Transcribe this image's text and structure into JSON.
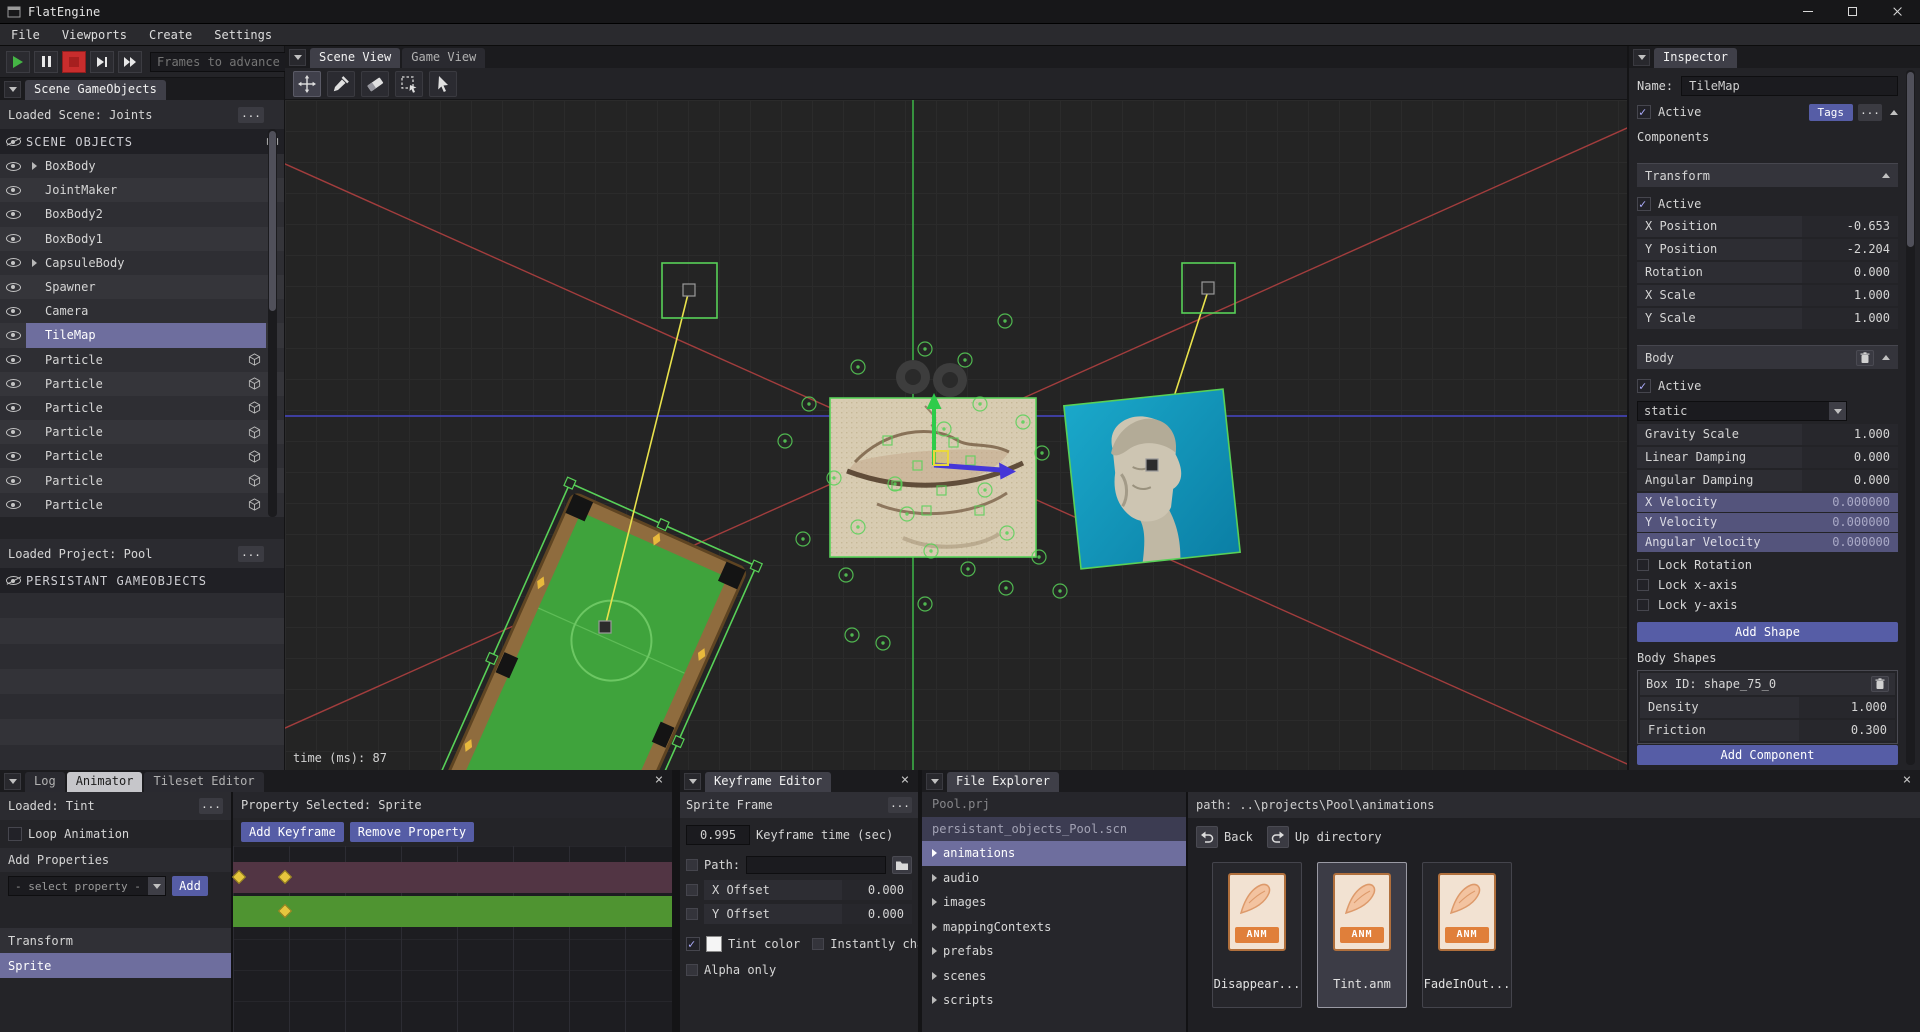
{
  "colors": {
    "accent": "#6e6e9e",
    "button": "#565da6",
    "selection-green": "#58d158",
    "axis-red": "#a23d3d",
    "axis-green": "#3cae46",
    "axis-blue": "#4646c8",
    "joint-yellow": "#e9e24c",
    "keyframe-yellow": "#e6c63e",
    "track-maroon": "#523544",
    "track-green": "#4f9431",
    "felt-green": "#3fa33c",
    "rail-brown": "#8f6c3e",
    "anm-orange": "#e07f3a",
    "play-green": "#45b545",
    "stop-red": "#c92d2d"
  },
  "window": {
    "title": "FlatEngine"
  },
  "menubar": {
    "items": [
      {
        "label": "File"
      },
      {
        "label": "Viewports"
      },
      {
        "label": "Create"
      },
      {
        "label": "Settings"
      }
    ]
  },
  "playbar": {
    "frames_placeholder": "Frames to advance"
  },
  "hierarchy": {
    "tab": "Scene GameObjects",
    "loaded": "Loaded Scene: Joints",
    "dots": "...",
    "header": "SCENE OBJECTS",
    "rows": [
      {
        "label": "BoxBody"
      },
      {
        "label": "JointMaker"
      },
      {
        "label": "BoxBody2"
      },
      {
        "label": "BoxBody1"
      },
      {
        "label": "CapsuleBody"
      },
      {
        "label": "Spawner"
      },
      {
        "label": "Camera"
      },
      {
        "label": "TileMap"
      },
      {
        "label": "Particle"
      },
      {
        "label": "Particle"
      },
      {
        "label": "Particle"
      },
      {
        "label": "Particle"
      },
      {
        "label": "Particle"
      },
      {
        "label": "Particle"
      },
      {
        "label": "Particle"
      }
    ]
  },
  "persistant": {
    "tab": "Persistant GameObjects",
    "loaded": "Loaded Project: Pool",
    "dots": "...",
    "header": "PERSISTANT GAMEOBJECTS"
  },
  "viewport": {
    "tabs": [
      {
        "label": "Scene View"
      },
      {
        "label": "Game View"
      }
    ],
    "time_text": "time (ms): 87"
  },
  "inspector": {
    "tab": "Inspector",
    "name_label": "Name:",
    "name_value": "TileMap",
    "active_label": "Active",
    "tags_button": "Tags",
    "dots": "...",
    "components_label": "Components",
    "transform": {
      "title": "Transform",
      "active_label": "Active",
      "fields": [
        {
          "label": "X Position",
          "value": "-0.653"
        },
        {
          "label": "Y Position",
          "value": "-2.204"
        },
        {
          "label": "Rotation",
          "value": "0.000"
        },
        {
          "label": "X Scale",
          "value": "1.000"
        },
        {
          "label": "Y Scale",
          "value": "1.000"
        }
      ]
    },
    "body": {
      "title": "Body",
      "active_label": "Active",
      "type_value": "static",
      "fields": [
        {
          "label": "Gravity Scale",
          "value": "1.000"
        },
        {
          "label": "Linear Damping",
          "value": "0.000"
        },
        {
          "label": "Angular Damping",
          "value": "0.000"
        }
      ],
      "velocity_fields": [
        {
          "label": "X Velocity",
          "value": "0.000000"
        },
        {
          "label": "Y Velocity",
          "value": "0.000000"
        },
        {
          "label": "Angular Velocity",
          "value": "0.000000"
        }
      ],
      "locks": [
        {
          "label": "Lock Rotation"
        },
        {
          "label": "Lock x-axis"
        },
        {
          "label": "Lock y-axis"
        }
      ],
      "add_shape_button": "Add Shape",
      "body_shapes_label": "Body Shapes",
      "shape": {
        "id_label": "Box ID: shape_75_0",
        "fields": [
          {
            "label": "Density",
            "value": "1.000"
          },
          {
            "label": "Friction",
            "value": "0.300"
          }
        ]
      }
    },
    "add_component_button": "Add Component"
  },
  "animator": {
    "tabs": [
      {
        "label": "Log"
      },
      {
        "label": "Animator"
      },
      {
        "label": "Tileset Editor"
      }
    ],
    "loaded": "Loaded: Tint",
    "dots": "...",
    "loop_label": "Loop Animation",
    "add_properties_label": "Add Properties",
    "property_select": "- select property -",
    "add_button": "Add",
    "properties": [
      {
        "label": "Transform"
      },
      {
        "label": "Sprite"
      }
    ],
    "selected_header": "Property Selected: Sprite",
    "add_keyframe_button": "Add Keyframe",
    "remove_property_button": "Remove Property"
  },
  "keyframe_editor": {
    "tab": "Keyframe Editor",
    "section_title": "Sprite Frame",
    "dots": "...",
    "time_value": "0.995",
    "time_label": "Keyframe time (sec)",
    "path_label": "Path:",
    "fields": [
      {
        "label": "X Offset",
        "value": "0.000"
      },
      {
        "label": "Y Offset",
        "value": "0.000"
      }
    ],
    "tint_label": "Tint color",
    "instant_label": "Instantly change",
    "alpha_label": "Alpha only"
  },
  "file_explorer": {
    "tab": "File Explorer",
    "tree": [
      {
        "label": "Pool.prj"
      },
      {
        "label": "persistant_objects_Pool.scn"
      },
      {
        "label": "animations"
      },
      {
        "label": "audio"
      },
      {
        "label": "images"
      },
      {
        "label": "mappingContexts"
      },
      {
        "label": "prefabs"
      },
      {
        "label": "scenes"
      },
      {
        "label": "scripts"
      }
    ],
    "path_text": "path: ..\\projects\\Pool\\animations",
    "back_button": "Back",
    "up_button": "Up directory",
    "files": [
      {
        "name": "Disappear...",
        "badge": "ANM"
      },
      {
        "name": "Tint.anm",
        "badge": "ANM"
      },
      {
        "name": "FadeInOut...",
        "badge": "ANM"
      }
    ]
  }
}
